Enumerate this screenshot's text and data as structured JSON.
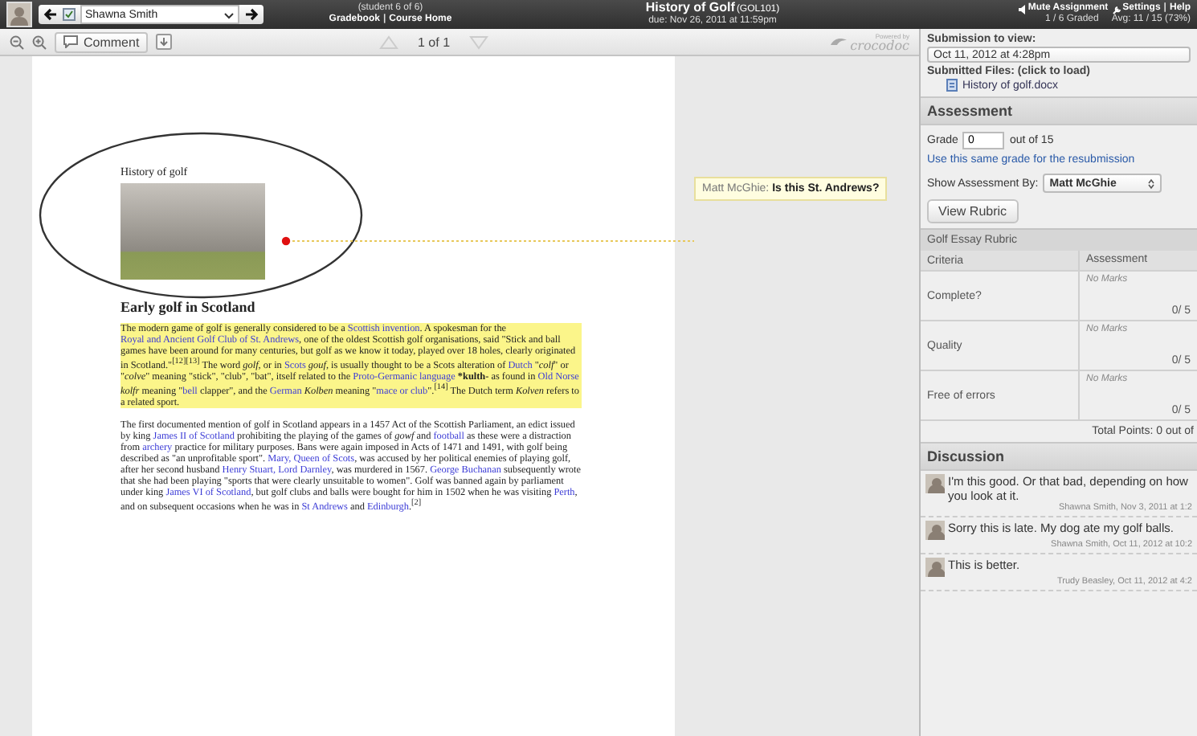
{
  "top_bar": {
    "student_select": {
      "value": "Shawna Smith"
    },
    "student_count": "(student 6 of 6)",
    "links": [
      "Gradebook",
      "Course Home"
    ],
    "links_separator": "|",
    "assignment_title": "History of Golf",
    "course_code": "(GOL101)",
    "due": "due: Nov 26, 2011 at 11:59pm",
    "actions": [
      {
        "kind": "mute",
        "label": "Mute Assignment"
      },
      {
        "kind": "settings",
        "label": "Settings"
      },
      {
        "kind": "plain",
        "label": "Help"
      }
    ],
    "actions_separator": "|",
    "graded": "1 / 6 Graded",
    "average": "Avg: 11 / 15 (73%)"
  },
  "toolbar": {
    "comment_button": "Comment",
    "page_indicator": "1 of 1",
    "powered_by": "Powered by",
    "brand": "crocodoc"
  },
  "document": {
    "title": "History of golf",
    "heading": "Early golf in Scotland",
    "paragraphs": [
      {
        "highlighted": true,
        "segments": [
          {
            "kind": "text",
            "text": "The modern game of golf is generally considered to be a "
          },
          {
            "kind": "link",
            "text": "Scottish invention"
          },
          {
            "kind": "text",
            "text": ". A spokesman for the "
          },
          {
            "kind": "link",
            "text": "Royal and Ancient Golf Club of St. Andrews"
          },
          {
            "kind": "text",
            "text": ", one of the oldest Scottish golf organisations, said \"Stick and ball games have been around for many centuries, but golf as we know it today, played over 18 holes, clearly originated in Scotland.\"$^{[12][13]}$ The word *golf*, or in "
          },
          {
            "kind": "link",
            "text": "Scots"
          },
          {
            "kind": "text",
            "text": " *gouf*, is usually thought to be a Scots alteration of "
          },
          {
            "kind": "link",
            "text": "Dutch"
          },
          {
            "kind": "text",
            "text": " \"*colf*\" or \"*colve*\" meaning \"stick\", \"club\", \"bat\", itself related to the "
          },
          {
            "kind": "link",
            "text": "Proto-Germanic language"
          },
          {
            "kind": "bold",
            "text": " *kulth-"
          },
          {
            "kind": "text",
            "text": " as found in "
          },
          {
            "kind": "link",
            "text": "Old Norse"
          },
          {
            "kind": "text",
            "text": " *kolfr* meaning \""
          },
          {
            "kind": "link",
            "text": "bell"
          },
          {
            "kind": "text",
            "text": " clapper\", and the "
          },
          {
            "kind": "link",
            "text": "German"
          },
          {
            "kind": "text",
            "text": " *Kolben* meaning \""
          },
          {
            "kind": "link",
            "text": "mace or club"
          },
          {
            "kind": "text",
            "text": "\".$^{[14]}$ The Dutch term *Kolven* refers to a related sport."
          }
        ]
      },
      {
        "highlighted": false,
        "segments": [
          {
            "kind": "text",
            "text": "The first documented mention of golf in Scotland appears in a 1457 Act of the Scottish Parliament, an edict issued by king "
          },
          {
            "kind": "link",
            "text": "James II of Scotland"
          },
          {
            "kind": "text",
            "text": " prohibiting the playing of the games of *gowf* and "
          },
          {
            "kind": "link",
            "text": "football"
          },
          {
            "kind": "text",
            "text": " as these were a distraction from "
          },
          {
            "kind": "link",
            "text": "archery"
          },
          {
            "kind": "text",
            "text": " practice for military purposes. Bans were again imposed in Acts of 1471 and 1491, with golf being described as \"an unprofitable sport\". "
          },
          {
            "kind": "link",
            "text": "Mary, Queen of Scots"
          },
          {
            "kind": "text",
            "text": ", was accused by her political enemies of playing golf, after her second husband "
          },
          {
            "kind": "link",
            "text": "Henry Stuart, Lord Darnley"
          },
          {
            "kind": "text",
            "text": ", was murdered in 1567. "
          },
          {
            "kind": "link",
            "text": "George Buchanan"
          },
          {
            "kind": "text",
            "text": " subsequently wrote that she had been playing \"sports that were clearly unsuitable to women\". Golf was banned again by parliament under king "
          },
          {
            "kind": "link",
            "text": "James VI of Scotland"
          },
          {
            "kind": "text",
            "text": ", but golf clubs and balls were bought for him in 1502 when he was visiting "
          },
          {
            "kind": "link",
            "text": "Perth"
          },
          {
            "kind": "text",
            "text": ", and on subsequent occasions when he was in "
          },
          {
            "kind": "link",
            "text": "St Andrews"
          },
          {
            "kind": "text",
            "text": " and "
          },
          {
            "kind": "link",
            "text": "Edinburgh"
          },
          {
            "kind": "text",
            "text": ".$^{[2]}$"
          }
        ]
      }
    ]
  },
  "annotations": [
    {
      "author": "Matt McGhie:",
      "text": "Is this St. Andrews?"
    }
  ],
  "panel": {
    "submission_label": "Submission to view:",
    "submission_select": {
      "value": "Oct 11, 2012 at 4:28pm"
    },
    "files_label": "Submitted Files: (click to load)",
    "files": [
      "History of golf.docx"
    ],
    "assessment": {
      "header": "Assessment",
      "grade_label": "Grade",
      "grade_input": {
        "value": "0"
      },
      "out_of": "out of 15",
      "same_grade_link": "Use this same grade for the resubmission",
      "show_by_label": "Show Assessment By:",
      "show_by_select": {
        "value": "Matt McGhie"
      },
      "view_rubric_button": "View Rubric"
    },
    "rubric": {
      "title": "Golf Essay Rubric",
      "columns": [
        "Criteria",
        "Assessment"
      ],
      "rows": [
        {
          "criterion": "Complete?",
          "marks": "No Marks",
          "score": "0/ 5"
        },
        {
          "criterion": "Quality",
          "marks": "No Marks",
          "score": "0/ 5"
        },
        {
          "criterion": "Free of errors",
          "marks": "No Marks",
          "score": "0/ 5"
        }
      ],
      "total": "Total Points: 0 out of"
    },
    "discussion": {
      "header": "Discussion",
      "comments": [
        {
          "text": "I'm this good. Or that bad, depending on how you look at it.",
          "meta": "Shawna Smith,  Nov 3, 2011 at 1:2"
        },
        {
          "text": "Sorry this is late. My dog ate my golf balls.",
          "meta": "Shawna Smith, Oct 11, 2012 at 10:2"
        },
        {
          "text": "This is better.",
          "meta": "Trudy Beasley, Oct 11, 2012 at 4:2"
        }
      ]
    }
  }
}
